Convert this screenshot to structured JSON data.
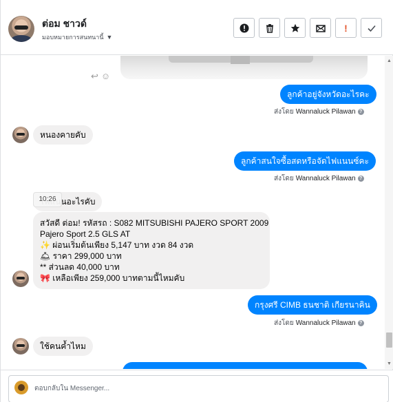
{
  "header": {
    "contact_name": "ต่อม ชาวด์",
    "assign_label": "มอบหมายการสนทนานี้",
    "actions": [
      {
        "name": "block-button",
        "icon": "alert-circle-icon"
      },
      {
        "name": "delete-button",
        "icon": "trash-icon"
      },
      {
        "name": "star-button",
        "icon": "star-icon"
      },
      {
        "name": "mark-unread-button",
        "icon": "envelope-icon"
      },
      {
        "name": "spam-button",
        "icon": "exclamation-icon"
      },
      {
        "name": "done-button",
        "icon": "check-icon"
      }
    ]
  },
  "thread": {
    "messages": [
      {
        "side": "out",
        "text": "ลูกค้าอยู่จังหวัดอะไรคะ",
        "sent_by_prefix": "ส่งโดย",
        "sent_by": "Wannaluck Pilawan"
      },
      {
        "side": "in",
        "text": "หนองคายคับ"
      },
      {
        "side": "out",
        "text": "ลูกค้าสนใจซื้อสดหรือจัดไฟแนนซ์คะ",
        "sent_by_prefix": "ส่งโดย",
        "sent_by": "Wannaluck Pilawan"
      },
      {
        "side": "in",
        "text": "ไฟแนนอะไรคับ",
        "tooltip": "10:26"
      },
      {
        "side": "in",
        "lines": [
          "สวัสดี ต่อม!   รหัสรถ : S082   MITSUBISHI PAJERO SPORT 2009",
          "Pajero Sport 2.5 GLS AT",
          "✨ ผ่อนเริ่มต้นเพียง 5,147 บาท งวด 84 งวด",
          "🛎 ราคา 299,000 บาท",
          "** ส่วนลด 40,000 บาท",
          "🎀 เหลือเพียง 259,000 บาทตามนี้ไหมคับ"
        ]
      },
      {
        "side": "out",
        "text": "กรุงศรี  CIMB ธนชาติ เกียรนาคิน",
        "sent_by_prefix": "ส่งโดย",
        "sent_by": "Wannaluck Pilawan"
      },
      {
        "side": "in",
        "text": "ใช้คนค้ำไหม"
      }
    ]
  },
  "composer": {
    "placeholder": "ตอบกลับใน Messenger..."
  },
  "colors": {
    "outgoing_bubble": "#0084ff",
    "incoming_bubble": "#f1f0f0"
  }
}
